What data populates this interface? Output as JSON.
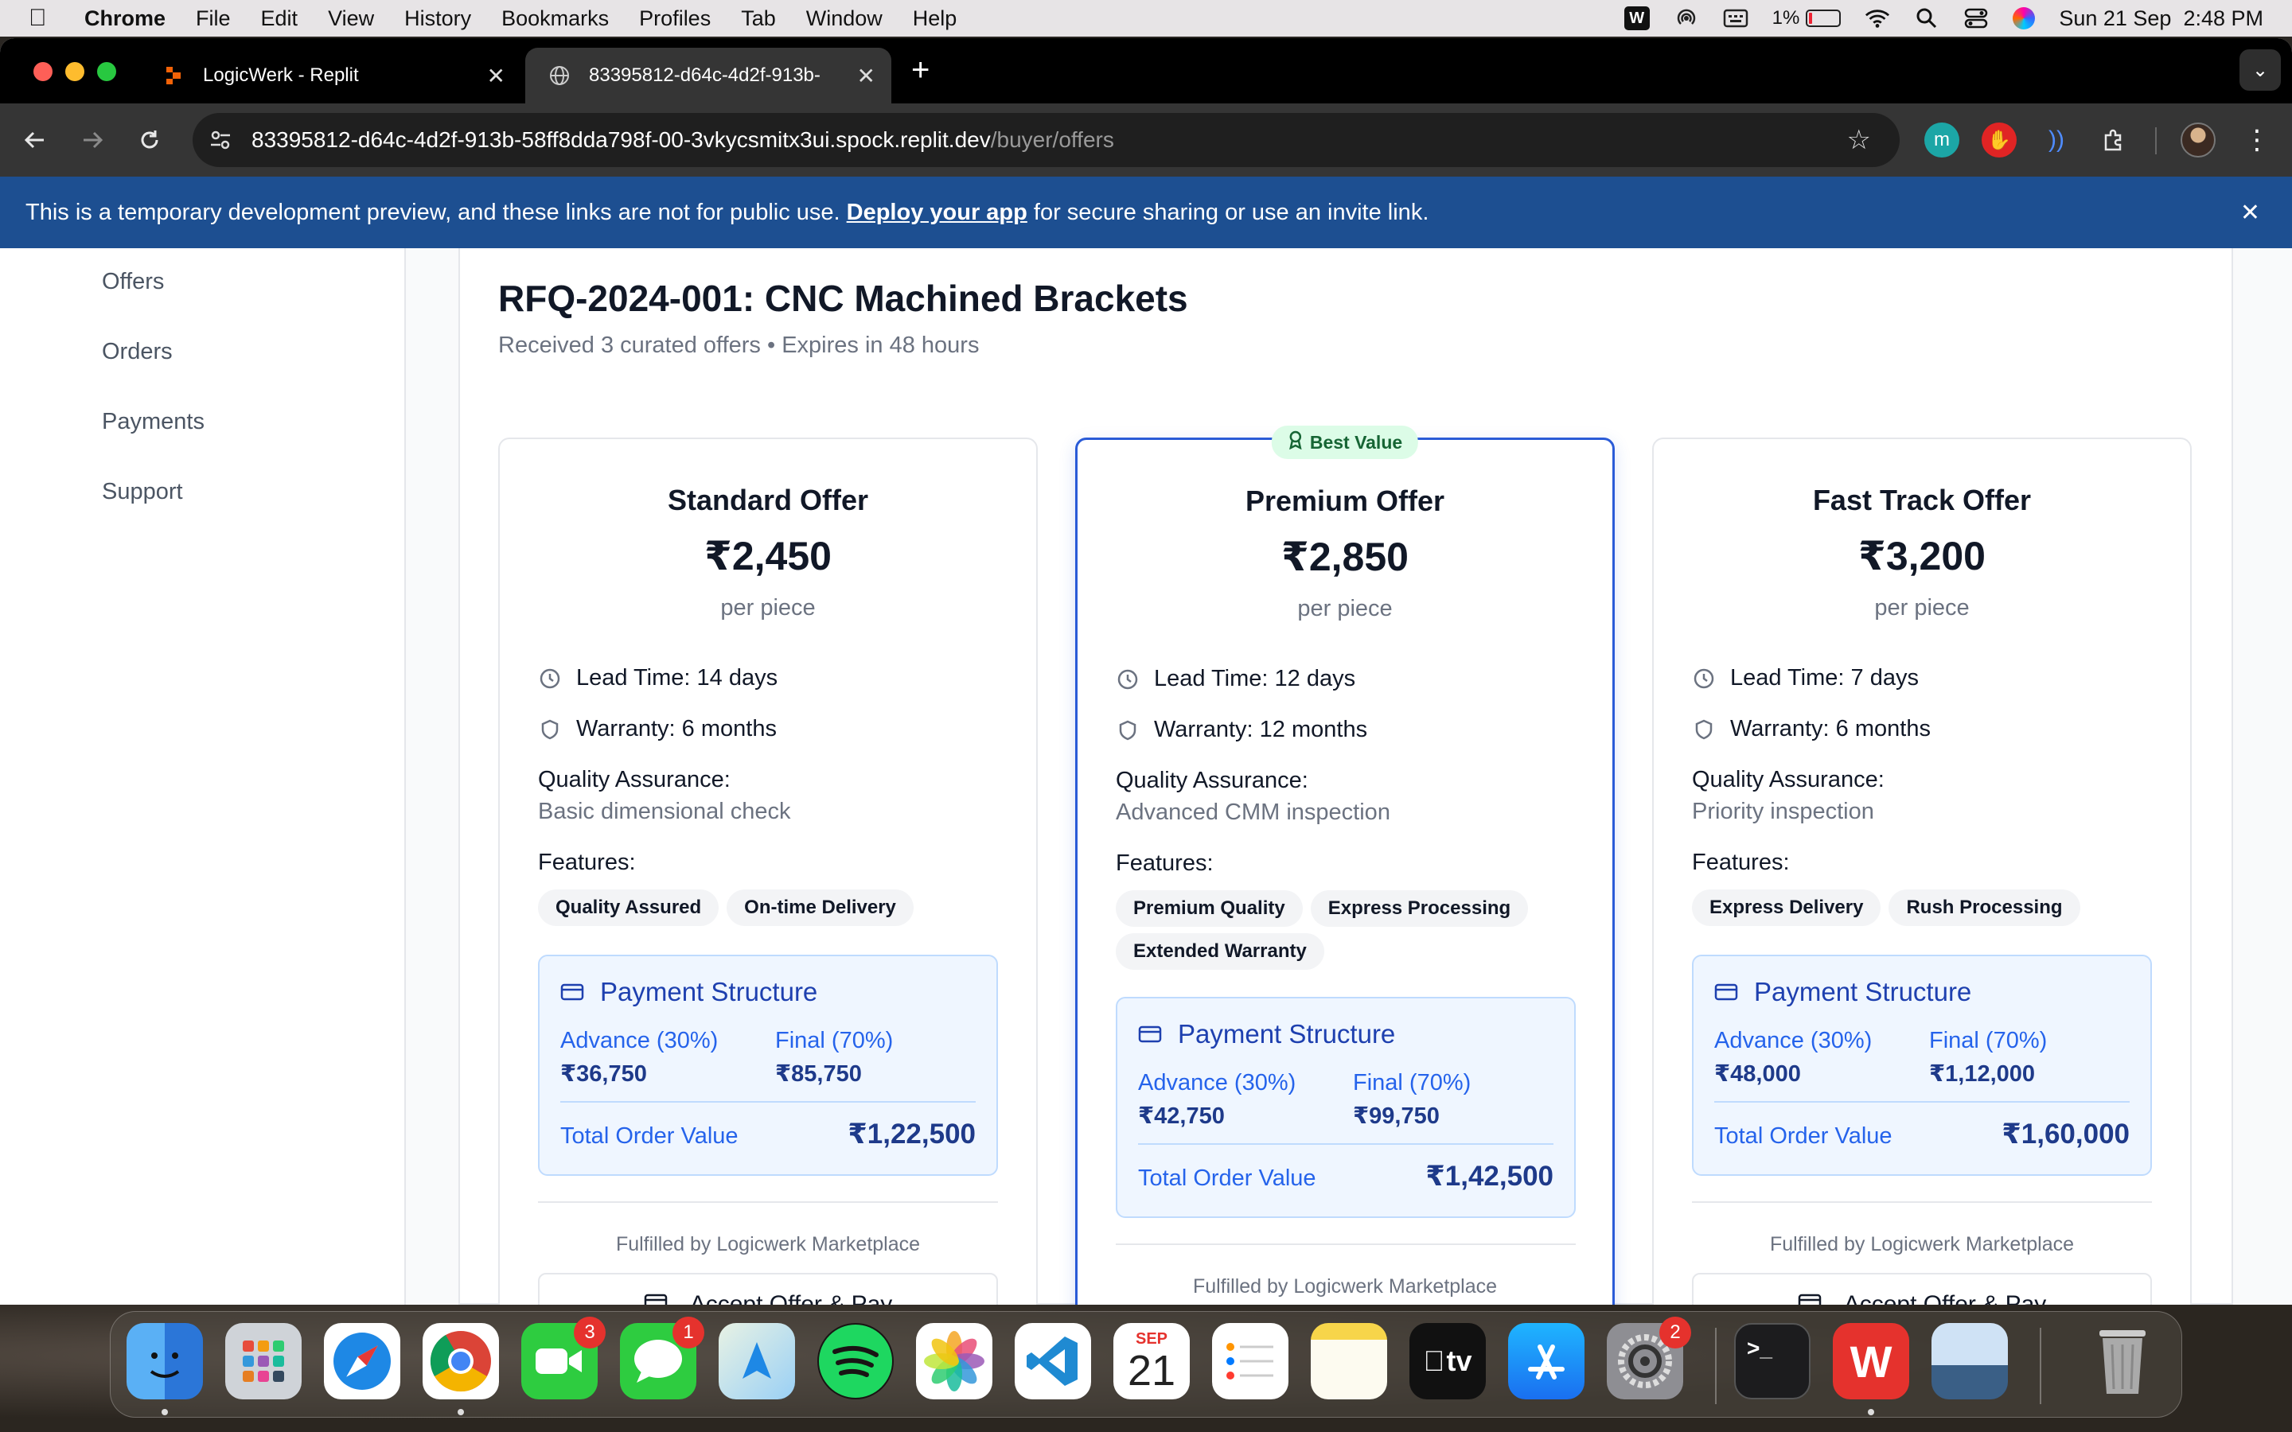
{
  "menubar": {
    "app": "Chrome",
    "items": [
      "File",
      "Edit",
      "View",
      "History",
      "Bookmarks",
      "Profiles",
      "Tab",
      "Window",
      "Help"
    ],
    "battery": "1%",
    "datetime": "Sun 21 Sep  2:48 PM"
  },
  "browser": {
    "tabs": [
      {
        "title": "LogicWerk - Replit"
      },
      {
        "title": "83395812-d64c-4d2f-913b-"
      }
    ],
    "url_host": "83395812-d64c-4d2f-913b-58ff8dda798f-00-3vkycsmitx3ui.spock.replit.dev",
    "url_path": "/buyer/offers",
    "ext_m_label": "m"
  },
  "banner": {
    "text_before": "This is a temporary development preview, and these links are not for public use. ",
    "link": "Deploy your app",
    "text_after": " for secure sharing or use an invite link."
  },
  "sidebar": {
    "items": [
      "Offers",
      "Orders",
      "Payments",
      "Support"
    ]
  },
  "rfq": {
    "title": "RFQ-2024-001: CNC Machined Brackets",
    "subtitle": "Received 3 curated offers • Expires in 48 hours"
  },
  "labels": {
    "best_value": "Best Value",
    "per_piece": "per piece",
    "quality_assurance": "Quality Assurance:",
    "features": "Features:",
    "payment_structure": "Payment Structure",
    "advance": "Advance (30%)",
    "final": "Final (70%)",
    "total": "Total Order Value",
    "fulfilled": "Fulfilled by Logicwerk Marketplace",
    "accept": "Accept Offer & Pay"
  },
  "offers": [
    {
      "name": "Standard Offer",
      "price": "₹2,450",
      "lead_time": "Lead Time: 14 days",
      "warranty": "Warranty: 6 months",
      "qa": "Basic dimensional check",
      "features": [
        "Quality Assured",
        "On-time Delivery"
      ],
      "advance": "₹36,750",
      "final": "₹85,750",
      "total": "₹1,22,500"
    },
    {
      "name": "Premium Offer",
      "price": "₹2,850",
      "lead_time": "Lead Time: 12 days",
      "warranty": "Warranty: 12 months",
      "qa": "Advanced CMM inspection",
      "features": [
        "Premium Quality",
        "Express Processing",
        "Extended Warranty"
      ],
      "advance": "₹42,750",
      "final": "₹99,750",
      "total": "₹1,42,500"
    },
    {
      "name": "Fast Track Offer",
      "price": "₹3,200",
      "lead_time": "Lead Time: 7 days",
      "warranty": "Warranty: 6 months",
      "qa": "Priority inspection",
      "features": [
        "Express Delivery",
        "Rush Processing"
      ],
      "advance": "₹48,000",
      "final": "₹1,12,000",
      "total": "₹1,60,000"
    }
  ],
  "dock": {
    "calendar_month": "SEP",
    "calendar_day": "21",
    "badges": {
      "facetime": "3",
      "messages": "1",
      "settings": "2"
    },
    "tv_label": "tv",
    "terminal_label": ">_"
  },
  "colors": {
    "banner": "#1d4f91",
    "accent": "#2a5bd7",
    "pay_bg": "#eff6ff",
    "best_badge": "#dcfce7"
  }
}
